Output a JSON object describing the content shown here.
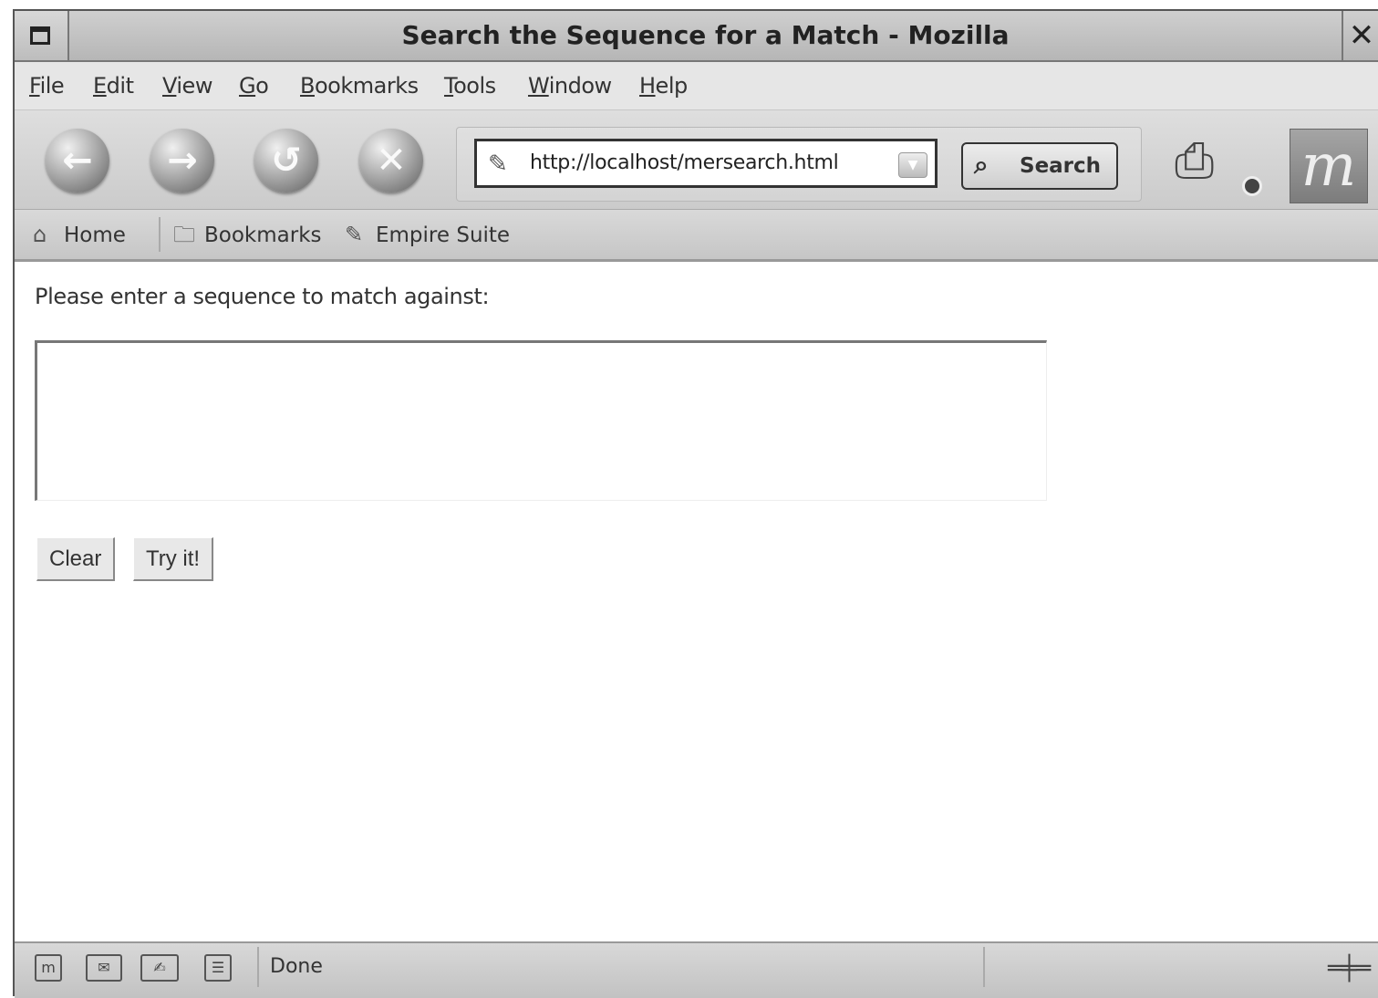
{
  "window": {
    "title": "Search the Sequence for a Match - Mozilla",
    "close_glyph": "✕"
  },
  "menubar": {
    "items": [
      "File",
      "Edit",
      "View",
      "Go",
      "Bookmarks",
      "Tools",
      "Window",
      "Help"
    ]
  },
  "navbar": {
    "back_icon": "back-arrow-icon",
    "forward_icon": "forward-arrow-icon",
    "reload_icon": "reload-icon",
    "stop_icon": "stop-icon",
    "url": "http://localhost/mersearch.html",
    "search_label": "Search"
  },
  "personal_toolbar": {
    "home_label": "Home",
    "bookmarks_label": "Bookmarks",
    "empire_label": "Empire Suite"
  },
  "content": {
    "prompt": "Please enter a sequence to match against:",
    "sequence_value": "",
    "clear_label": "Clear",
    "try_label": "Try it!"
  },
  "statusbar": {
    "status_text": "Done"
  }
}
